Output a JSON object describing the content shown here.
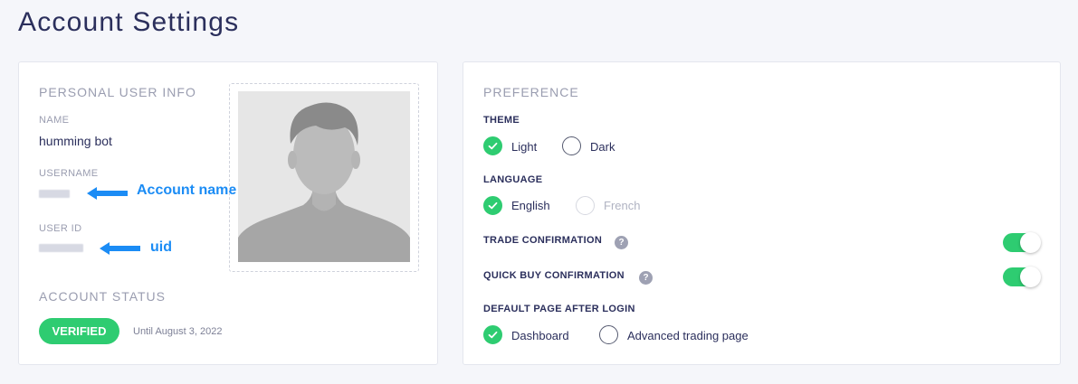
{
  "page": {
    "title": "Account Settings"
  },
  "personal": {
    "section_title": "PERSONAL USER INFO",
    "name_label": "NAME",
    "name_value": "humming bot",
    "username_label": "USERNAME",
    "userid_label": "USER ID",
    "status_title": "ACCOUNT STATUS",
    "status_badge": "VERIFIED",
    "status_until": "Until August 3, 2022"
  },
  "annotations": {
    "username_note": "Account name",
    "userid_note": "uid",
    "color": "#1b8cf5"
  },
  "preference": {
    "section_title": "PREFERENCE",
    "theme": {
      "label": "THEME",
      "options": [
        {
          "label": "Light",
          "selected": true
        },
        {
          "label": "Dark",
          "selected": false
        }
      ]
    },
    "language": {
      "label": "LANGUAGE",
      "options": [
        {
          "label": "English",
          "selected": true
        },
        {
          "label": "French",
          "selected": false,
          "disabled": true
        }
      ]
    },
    "trade_confirmation": {
      "label": "TRADE CONFIRMATION",
      "help": "?",
      "enabled": true
    },
    "quick_buy_confirmation": {
      "label": "QUICK BUY CONFIRMATION",
      "help": "?",
      "enabled": true
    },
    "default_page": {
      "label": "DEFAULT PAGE AFTER LOGIN",
      "options": [
        {
          "label": "Dashboard",
          "selected": true
        },
        {
          "label": "Advanced trading page",
          "selected": false
        }
      ]
    }
  },
  "colors": {
    "accent_green": "#2ecc71",
    "title": "#2b2f5c",
    "muted": "#9a9db0"
  }
}
